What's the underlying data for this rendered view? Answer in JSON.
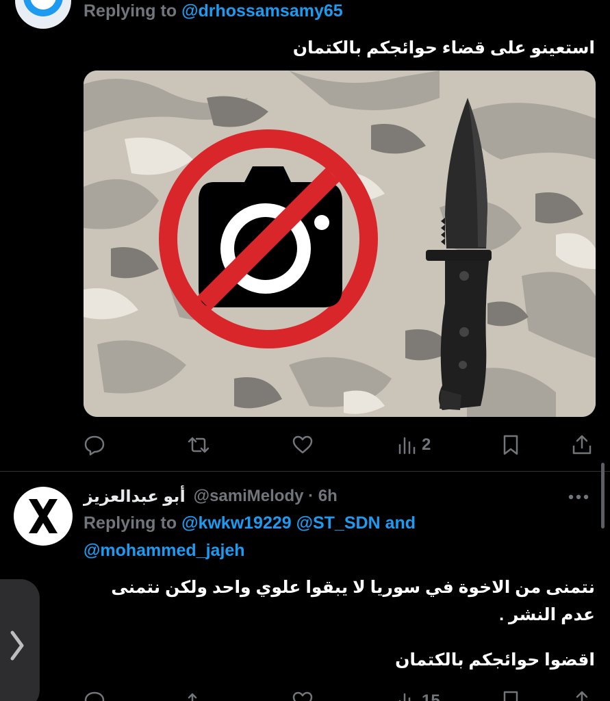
{
  "tweet1": {
    "replying_to_label": "Replying to ",
    "replying_to_handle": "@drhossamsamy65",
    "text": "استعينو على قضاء حوائجكم بالكتمان",
    "media_icons": [
      "no-camera-sign",
      "combat-knife"
    ],
    "actions": {
      "reply_count": "",
      "retweet_count": "",
      "like_count": "",
      "views_count": "2"
    }
  },
  "tweet2": {
    "display_name": "أبو عبدالعزيز",
    "handle_time": "@samiMelody · 6h",
    "replying_to_label": "Replying to ",
    "replying_to_handles_line1": "@kwkw19229 @ST_SDN and",
    "replying_to_handles_line2": "@mohammed_jajeh",
    "text_line1": "نتمنى من الاخوة في سوريا لا يبقوا علوي واحد ولكن نتمنى",
    "text_line2": "عدم النشر .",
    "text_line3": "اقضوا حوائجكم بالكتمان",
    "views_count": "15"
  },
  "colors": {
    "background": "#000000",
    "text": "#e7e9ea",
    "muted": "#71767b",
    "accent": "#1d9bf0",
    "divider": "#2f3336",
    "prohibition_red": "#d9262b"
  }
}
